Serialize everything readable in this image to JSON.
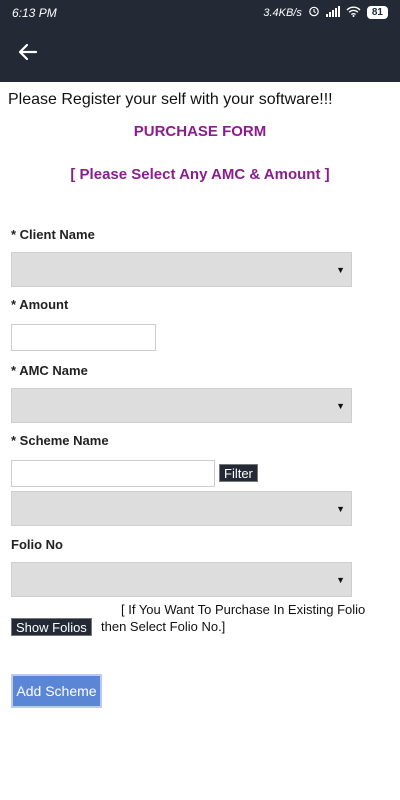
{
  "status_bar": {
    "time": "6:13 PM",
    "net_speed": "3.4KB/s",
    "battery": "81"
  },
  "app_bar": {
    "back_icon": "arrow-left-icon"
  },
  "content": {
    "intro": "Please Register your self with your software!!!",
    "form_title": "PURCHASE FORM",
    "form_subtitle": "[ Please Select Any AMC & Amount ]"
  },
  "fields": {
    "client_name": {
      "label": "* Client Name",
      "value": ""
    },
    "amount": {
      "label": "* Amount",
      "value": ""
    },
    "amc_name": {
      "label": "* AMC Name",
      "value": ""
    },
    "scheme_name": {
      "label": "* Scheme Name",
      "filter_value": "",
      "filter_label": "Filter",
      "value": ""
    },
    "folio_no": {
      "label": "Folio No",
      "value": ""
    }
  },
  "folio_hint": {
    "show_folios_label": "Show Folios",
    "line1": "[ If You Want To Purchase In Existing Folio",
    "line2": "then Select Folio No.]"
  },
  "actions": {
    "add_scheme_label": "Add Scheme"
  },
  "colors": {
    "header_bg": "#232a36",
    "title_purple": "#8b1d8f",
    "select_bg": "#dddddd",
    "button_blue": "#5b86d6"
  }
}
